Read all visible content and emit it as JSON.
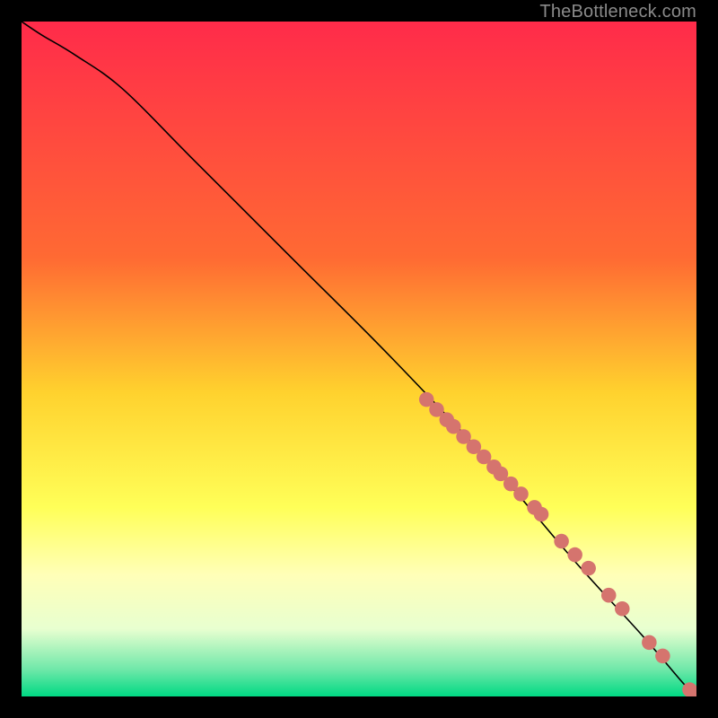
{
  "watermark": "TheBottleneck.com",
  "chart_data": {
    "type": "line",
    "title": "",
    "xlabel": "",
    "ylabel": "",
    "xlim": [
      0,
      100
    ],
    "ylim": [
      0,
      100
    ],
    "gradient_stops": [
      {
        "offset": 0,
        "color": "#ff2b4a"
      },
      {
        "offset": 35,
        "color": "#ff6a33"
      },
      {
        "offset": 55,
        "color": "#ffd22e"
      },
      {
        "offset": 72,
        "color": "#ffff58"
      },
      {
        "offset": 82,
        "color": "#ffffb8"
      },
      {
        "offset": 90,
        "color": "#e8ffd0"
      },
      {
        "offset": 96,
        "color": "#6fe8a9"
      },
      {
        "offset": 100,
        "color": "#00d983"
      }
    ],
    "series": [
      {
        "name": "curve",
        "type": "line",
        "x": [
          0,
          3,
          8,
          15,
          25,
          40,
          55,
          70,
          82,
          92,
          98,
          100
        ],
        "y": [
          100,
          98,
          95,
          90,
          80,
          65,
          50,
          34,
          20,
          9,
          2,
          0
        ]
      },
      {
        "name": "points",
        "type": "scatter",
        "color": "#d5746e",
        "radius": 1.1,
        "x": [
          60,
          61.5,
          63,
          64,
          65.5,
          67,
          68.5,
          70,
          71,
          72.5,
          74,
          76,
          77,
          80,
          82,
          84,
          87,
          89,
          93,
          95,
          99,
          100
        ],
        "y": [
          44,
          42.5,
          41,
          40,
          38.5,
          37,
          35.5,
          34,
          33,
          31.5,
          30,
          28,
          27,
          23,
          21,
          19,
          15,
          13,
          8,
          6,
          1,
          0.5
        ]
      }
    ]
  }
}
